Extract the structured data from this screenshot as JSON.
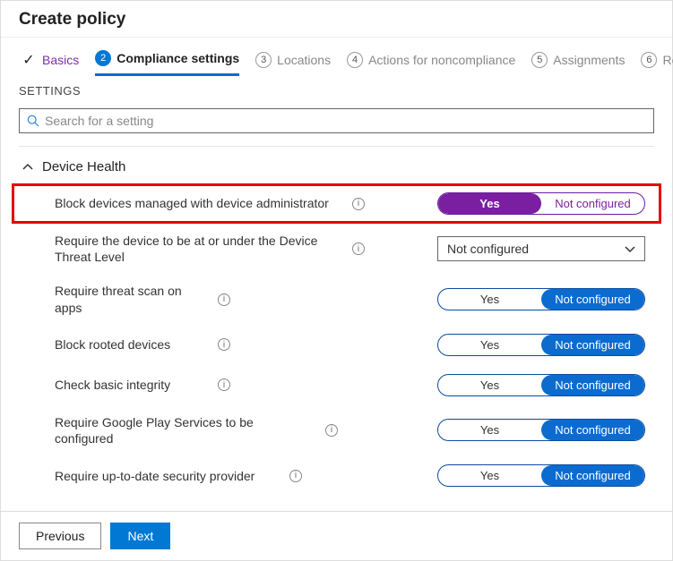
{
  "header": {
    "title": "Create policy"
  },
  "tabs": {
    "basics": "Basics",
    "compliance": "Compliance settings",
    "locations": "Locations",
    "actions": "Actions for noncompliance",
    "assignments": "Assignments",
    "review": "Review"
  },
  "settingsLabel": "SETTINGS",
  "search": {
    "placeholder": "Search for a setting"
  },
  "section": {
    "deviceHealth": "Device Health"
  },
  "rows": {
    "blockAdmin": {
      "label": "Block devices managed with device administrator",
      "yes": "Yes",
      "no": "Not configured"
    },
    "threatLevel": {
      "label": "Require the device to be at or under the Device Threat Level",
      "value": "Not configured"
    },
    "threatScan": {
      "label": "Require threat scan on apps",
      "yes": "Yes",
      "no": "Not configured"
    },
    "rooted": {
      "label": "Block rooted devices",
      "yes": "Yes",
      "no": "Not configured"
    },
    "integrity": {
      "label": "Check basic integrity",
      "yes": "Yes",
      "no": "Not configured"
    },
    "playServices": {
      "label": "Require Google Play Services to be configured",
      "yes": "Yes",
      "no": "Not configured"
    },
    "securityProvider": {
      "label": "Require up-to-date security provider",
      "yes": "Yes",
      "no": "Not configured"
    }
  },
  "footer": {
    "previous": "Previous",
    "next": "Next"
  }
}
